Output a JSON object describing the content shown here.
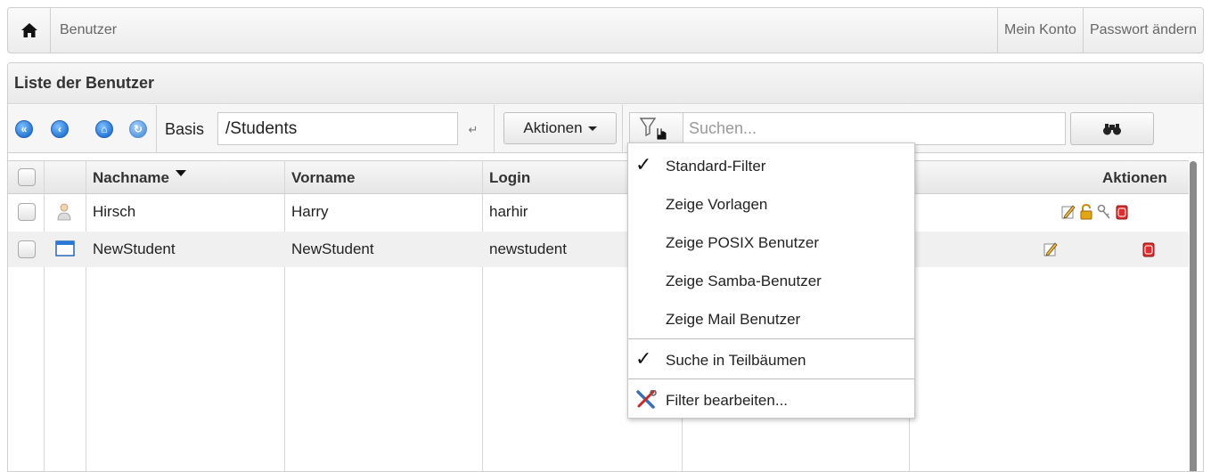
{
  "nav": {
    "breadcrumb": "Benutzer",
    "my_account": "Mein Konto",
    "change_password": "Passwort ändern"
  },
  "panel": {
    "title": "Liste der Benutzer"
  },
  "toolbar": {
    "basis_label": "Basis",
    "basis_value": "/Students",
    "actions_label": "Aktionen",
    "search_placeholder": "Suchen..."
  },
  "table": {
    "columns": [
      "Nachname",
      "Vorname",
      "Login",
      "Aktionen"
    ],
    "sort_column": "Nachname",
    "rows": [
      {
        "nachname": "Hirsch",
        "vorname": "Harry",
        "login": "harhir",
        "type_icon": "user-icon"
      },
      {
        "nachname": "NewStudent",
        "vorname": "NewStudent",
        "login": "newstudent",
        "type_icon": "template-window-icon"
      }
    ]
  },
  "filter_menu": {
    "items": [
      {
        "label": "Standard-Filter",
        "checked": true
      },
      {
        "label": "Zeige Vorlagen",
        "checked": false
      },
      {
        "label": "Zeige POSIX Benutzer",
        "checked": false
      },
      {
        "label": "Zeige Samba-Benutzer",
        "checked": false
      },
      {
        "label": "Zeige Mail Benutzer",
        "checked": false
      },
      {
        "label": "Suche in Teilbäumen",
        "checked": true
      },
      {
        "label": "Filter bearbeiten...",
        "checked": false,
        "icon": "tools-icon"
      }
    ]
  },
  "colors": {
    "accent_blue": "#2a79d6",
    "delete_red": "#d9302f",
    "lock_gold": "#e6a417"
  }
}
